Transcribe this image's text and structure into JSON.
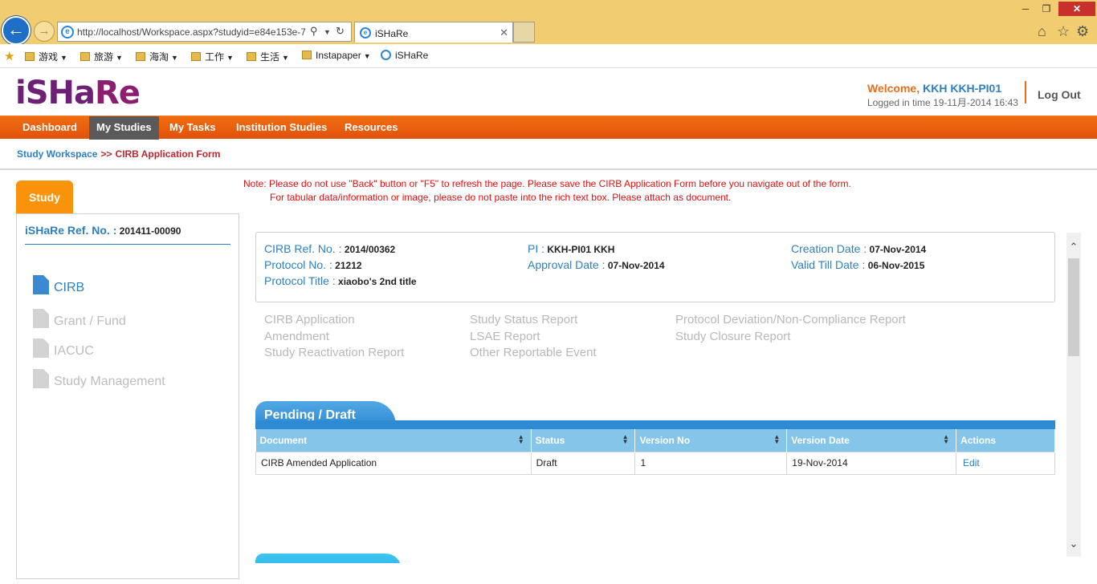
{
  "browser": {
    "url": "http://localhost/Workspace.aspx?studyid=e84e153e-7",
    "tab_title": "iSHaRe",
    "favorites": [
      {
        "label": "游戏",
        "type": "folder"
      },
      {
        "label": "旅游",
        "type": "folder"
      },
      {
        "label": "海淘",
        "type": "folder"
      },
      {
        "label": "工作",
        "type": "folder"
      },
      {
        "label": "生活",
        "type": "folder"
      },
      {
        "label": "Instapaper",
        "type": "folder"
      },
      {
        "label": "iSHaRe",
        "type": "page"
      }
    ]
  },
  "header": {
    "logo_part1": "iSHa",
    "logo_part2": "Re",
    "welcome_label": "Welcome,",
    "user": "KKH KKH-PI01",
    "login_time": "Logged in time 19-11月-2014 16:43",
    "logout": "Log Out"
  },
  "nav": [
    {
      "label": "Dashboard",
      "active": false
    },
    {
      "label": "My Studies",
      "active": true
    },
    {
      "label": "My Tasks",
      "active": false
    },
    {
      "label": "Institution Studies",
      "active": false
    },
    {
      "label": "Resources",
      "active": false
    }
  ],
  "breadcrumb": {
    "link": "Study Workspace",
    "separator": ">>",
    "current": "CIRB Application Form"
  },
  "sidebar": {
    "tab": "Study",
    "ref_label": "iSHaRe Ref. No. :",
    "ref_value": "201411-00090",
    "items": [
      {
        "label": "CIRB",
        "active": true
      },
      {
        "label": "Grant / Fund",
        "active": false
      },
      {
        "label": "IACUC",
        "active": false
      },
      {
        "label": "Study Management",
        "active": false
      }
    ]
  },
  "notes": {
    "line1": "Note: Please do not use \"Back\" button or \"F5\" to refresh the page. Please save the CIRB Application Form before you navigate out of the form.",
    "line2": "For tabular data/information or image, please do not paste into the rich text box. Please attach as document."
  },
  "study_info": {
    "cirb_ref_label": "CIRB Ref. No. :",
    "cirb_ref": "2014/00362",
    "protocol_no_label": "Protocol No. :",
    "protocol_no": "21212",
    "protocol_title_label": "Protocol Title :",
    "protocol_title": "xiaobo's 2nd title",
    "pi_label": "PI :",
    "pi": "KKH-PI01 KKH",
    "approval_label": "Approval Date :",
    "approval_date": "07-Nov-2014",
    "creation_label": "Creation Date :",
    "creation_date": "07-Nov-2014",
    "valid_label": "Valid Till Date :",
    "valid_date": "06-Nov-2015"
  },
  "form_links": [
    "CIRB Application",
    "Amendment",
    "Study Reactivation Report",
    "Study Status Report",
    "LSAE Report",
    "Other Reportable Event",
    "Protocol Deviation/Non-Compliance Report",
    "Study Closure Report"
  ],
  "pending": {
    "title": "Pending / Draft",
    "columns": [
      "Document",
      "Status",
      "Version No",
      "Version Date",
      "Actions"
    ],
    "rows": [
      {
        "document": "CIRB Amended Application",
        "status": "Draft",
        "version": "1",
        "date": "19-Nov-2014",
        "action": "Edit"
      }
    ]
  },
  "colors": {
    "nav_orange": "#e86f1c",
    "link_blue": "#2e7fc1",
    "note_red": "#e01010",
    "tab_orange": "#f9930c",
    "table_header_blue": "#86c5ea"
  }
}
